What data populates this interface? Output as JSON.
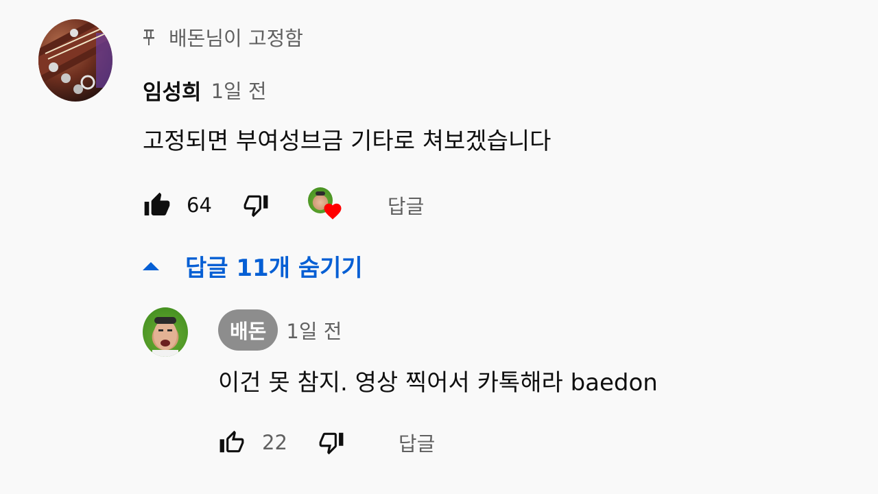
{
  "pinned": {
    "label": "배돈님이 고정함"
  },
  "comment": {
    "author": "임성희",
    "time": "1일 전",
    "text": "고정되면 부여성브금 기타로 쳐보겠습니다",
    "likes": "64",
    "reply_label": "답글",
    "creator_heart": true
  },
  "replies_toggle": {
    "label": "답글 11개 숨기기"
  },
  "reply": {
    "author": "배돈",
    "time": "1일 전",
    "text": "이건 못 참지. 영상 찍어서 카톡해라 baedon",
    "likes": "22",
    "reply_label": "답글"
  },
  "colors": {
    "background": "#f9f9f9",
    "link_blue": "#065fd4",
    "heart_red": "#ff0000",
    "badge_gray": "#8d8d8d",
    "secondary_text": "#606060"
  },
  "icons": [
    "pin-icon",
    "thumb-up-filled-icon",
    "thumb-down-icon",
    "creator-heart-icon",
    "chevron-up-icon",
    "thumb-up-outline-icon"
  ]
}
